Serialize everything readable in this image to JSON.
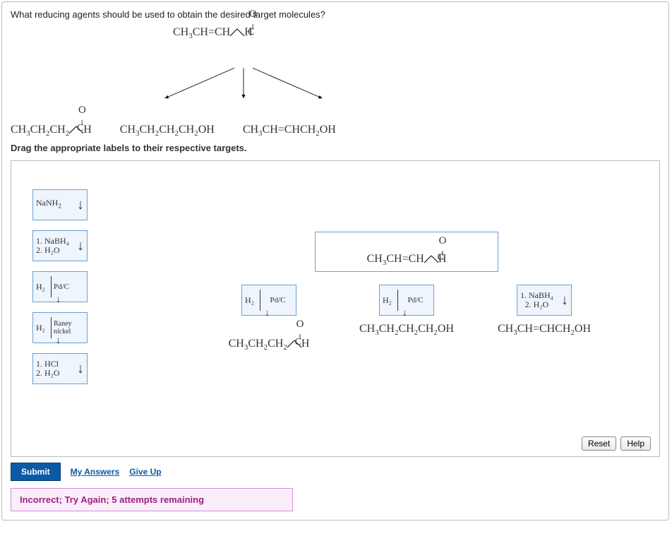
{
  "question": "What reducing agents should be used to obtain the desired target molecules?",
  "starting_material": "CH₃CH=CH-C(=O)-H",
  "products": {
    "left": "CH₃CH₂CH₂-C(=O)-H",
    "middle": "CH₃CH₂CH₂CH₂OH",
    "right": "CH₃CH=CHCH₂OH"
  },
  "instruction": "Drag the appropriate labels to their respective targets.",
  "labels": {
    "nanh2": "NaNH₂",
    "nabh4": {
      "line1": "1. NaBH₄",
      "line2": "2. H₂O"
    },
    "h2_pdc": {
      "left": "H₂",
      "right": "Pd/C"
    },
    "h2_raney": {
      "left": "H₂",
      "right": "Raney nickel"
    },
    "hcl": {
      "line1": "1. HCl",
      "line2": "2. H₂O"
    }
  },
  "placed": {
    "target1": "h2_pdc",
    "target2": "h2_pdc",
    "target3": "nabh4"
  },
  "buttons": {
    "reset": "Reset",
    "help": "Help",
    "submit": "Submit",
    "my_answers": "My Answers",
    "give_up": "Give Up"
  },
  "feedback": "Incorrect; Try Again; 5 attempts remaining"
}
